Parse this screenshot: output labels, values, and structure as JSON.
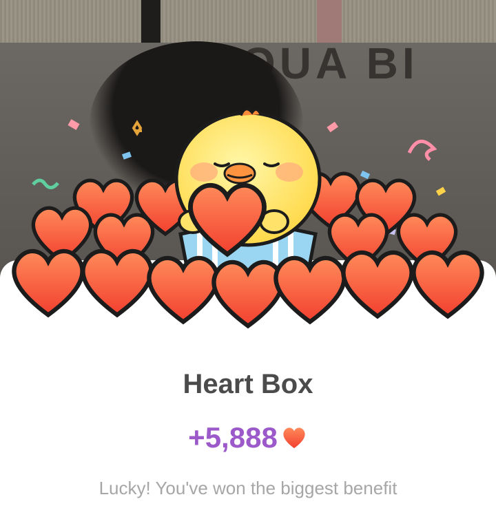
{
  "reward_card": {
    "title": "Heart Box",
    "amount": "+5,888",
    "message": "Lucky! You've won the biggest benefit"
  },
  "background": {
    "sign_text": "QUA BI"
  },
  "icons": {
    "reward_icon": "heart-icon",
    "mascot": "chick-icon",
    "gift": "gift-box-icon",
    "decor": "confetti-icon"
  },
  "colors": {
    "amount": "#9b59c9",
    "title": "#4b4b4b",
    "message": "#a6a6a6",
    "heart": "#ff5a3c"
  }
}
